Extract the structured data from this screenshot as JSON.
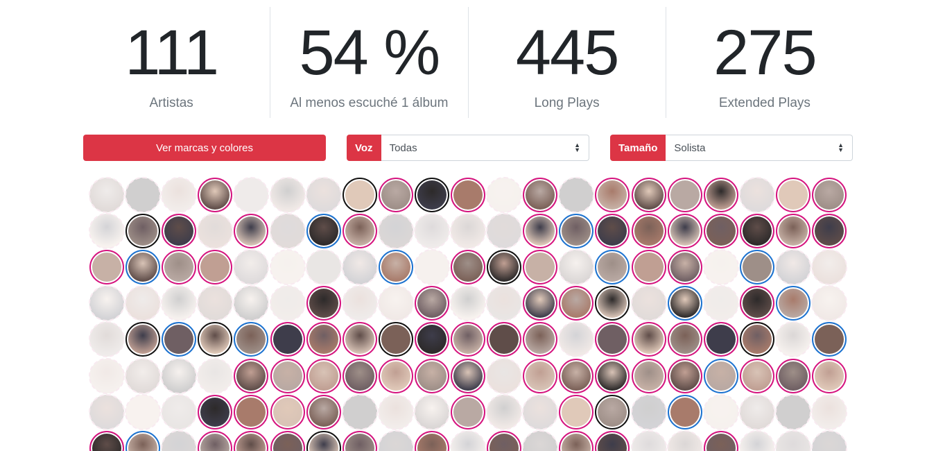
{
  "stats": [
    {
      "value": "111",
      "label": "Artistas"
    },
    {
      "value": "54 %",
      "label": "Al menos escuché 1 álbum"
    },
    {
      "value": "445",
      "label": "Long Plays"
    },
    {
      "value": "275",
      "label": "Extended Plays"
    }
  ],
  "controls": {
    "brands_button": "Ver marcas y colores",
    "voz": {
      "label": "Voz",
      "value": "Todas"
    },
    "tamano": {
      "label": "Tamaño",
      "value": "Solista"
    }
  },
  "grid": {
    "rows": [
      "ddddddddddddddddddddd",
      "ddddddddddddddddddddd",
      "ddddddddddddddddddddd",
      "ddddddddddddddddddddd",
      "ddddddddddddddddddddd",
      "ddddddddddddddddddddd",
      "ddddddddddddddddddddd",
      "ddddddddddddddddddddd"
    ],
    "active_rows": [
      "...p...kpkp.p.pppp.pp",
      ".kp.p.bp....pbppppppp",
      "pbpp....b.pkp.bpp b...",
      "......p..p..ppk.b.pb.",
      ".kbkbpppkpppp.ppppk.bp.",
      "....ppppppp.pppppbpppp",
      "...pppp...p..pk.b....",
      "pb.pppkp.p.p.ap..p..."
    ],
    "colors": [
      "#b9a9a3",
      "#5f4d49",
      "#c7b1a6",
      "#2d2a2a",
      "#7b6158",
      "#d8c3b6",
      "#a87b6b",
      "#3e3d4b",
      "#9e8f88",
      "#e0c9b9",
      "#6f5f63",
      "#c09f93"
    ]
  }
}
